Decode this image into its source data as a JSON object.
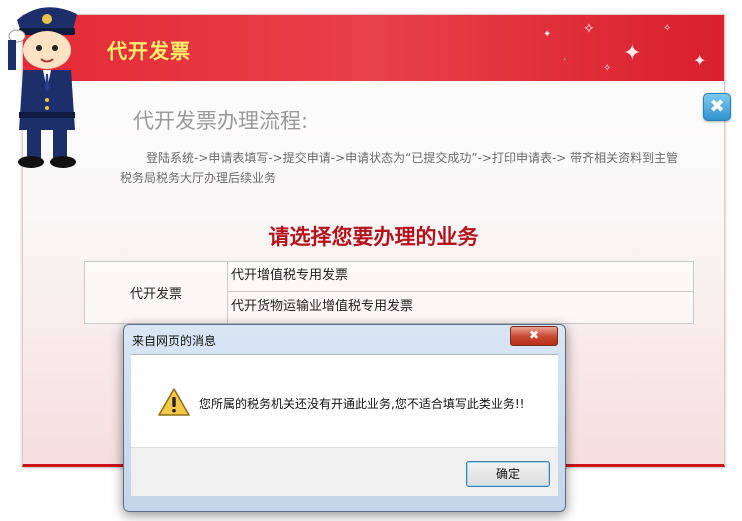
{
  "panel": {
    "title": "代开发票",
    "close_icon": "close-x-icon"
  },
  "process": {
    "title": "代开发票办理流程:",
    "description": "登陆系统->申请表填写->提交申请->申请状态为“已提交成功”->打印申请表-> 带齐相关资料到主管税务局税务大厅办理后续业务"
  },
  "select_heading": "请选择您要办理的业务",
  "business_table": {
    "category": "代开发票",
    "items": [
      "代开增值税专用发票",
      "代开货物运输业增值税专用发票"
    ]
  },
  "dialog": {
    "title": "来自网页的消息",
    "close_label": "✖",
    "icon": "warning-icon",
    "message": "您所属的税务机关还没有开通此业务,您不适合填写此类业务!!",
    "ok_label": "确定"
  },
  "colors": {
    "header_red": "#e42a36",
    "title_yellow": "#fff36a",
    "heading_red": "#b5121b"
  }
}
